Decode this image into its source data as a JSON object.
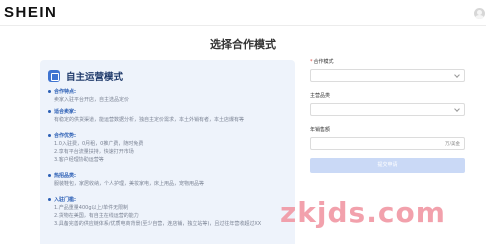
{
  "header": {
    "logo_text": "SHEIN",
    "user_icon": "user-avatar-icon"
  },
  "page_title": "选择合作模式",
  "mode_card": {
    "icon": "mode-icon",
    "title": "自主运营模式",
    "sections": [
      {
        "heading": "合作特点:",
        "lines": [
          "卖家入驻平台开店，自主选品定价"
        ]
      },
      {
        "heading": "适合卖家:",
        "lines": [
          "有稳定的供货渠道，能运营数据分析，独自主定价需求，本土外销有者，本土店爆有等"
        ]
      },
      {
        "heading": "合作优势:",
        "lines": [
          "1.0入驻费，0月租，0推广费，随时免费",
          "2.享有平台流量扶持，快速打开市场",
          "3.客户经理协助运营等"
        ]
      },
      {
        "heading": "热招品类:",
        "lines": [
          "服装鞋包，家居收纳，个人护理，美妆家电，床上用品，宠物用品等"
        ]
      },
      {
        "heading": "入驻门槛:",
        "lines": [
          "1.产品重量400g以上/单件无限制",
          "2.货物在美国，有自主在线运营的能力",
          "3.具备完善的供应链体系/优质电商背景(至少自营，连店铺，独立站等)，且过往年营收超过XX"
        ]
      }
    ]
  },
  "form": {
    "mode_label": "合作模式",
    "mode_required": "*",
    "category_label": "主营品类",
    "revenue_label": "年销售额",
    "revenue_unit": "万/美金",
    "submit_label": "提交申请"
  },
  "watermark": "zkjds.com",
  "colors": {
    "accent": "#3f74d1",
    "panel_bg": "#eef3fb",
    "button_disabled": "#cad9f6",
    "watermark": "#f19aa6"
  }
}
